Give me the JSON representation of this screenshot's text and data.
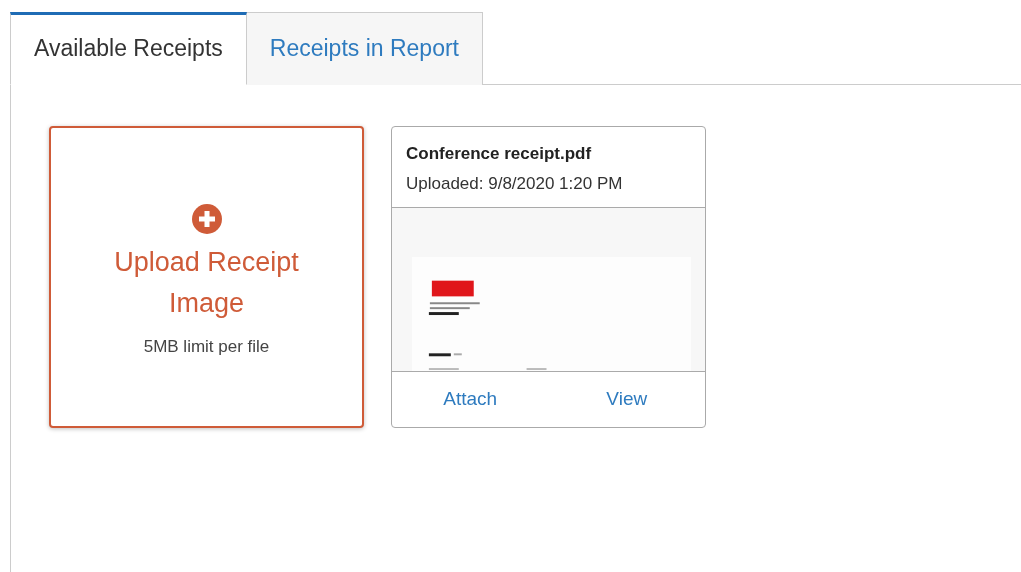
{
  "tabs": [
    {
      "label": "Available Receipts",
      "selected": true
    },
    {
      "label": "Receipts in Report",
      "selected": false
    }
  ],
  "upload": {
    "title": "Upload Receipt Image",
    "note": "5MB limit per file"
  },
  "receipts": [
    {
      "file_name": "Conference receipt.pdf",
      "uploaded": "Uploaded: 9/8/2020 1:20 PM",
      "actions": [
        "Attach",
        "View"
      ]
    }
  ]
}
